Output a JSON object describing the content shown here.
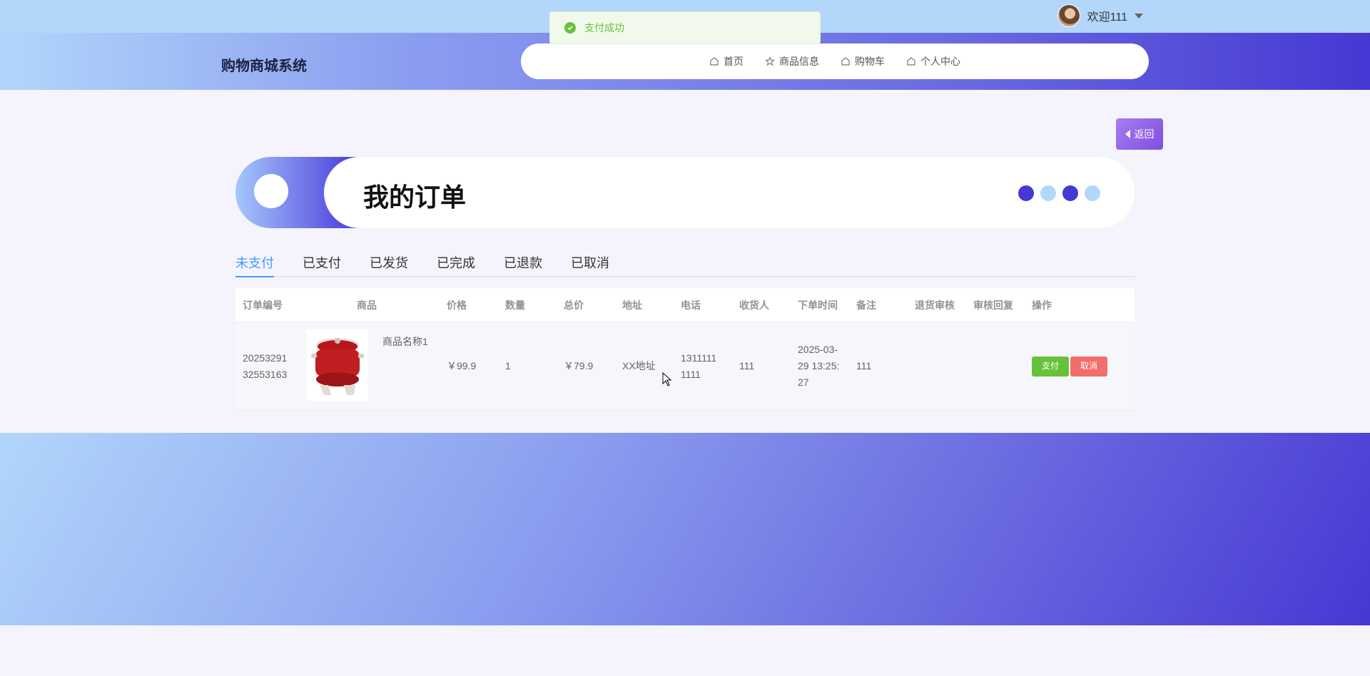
{
  "app": {
    "brand": "购物商城系统"
  },
  "user": {
    "welcome": "欢迎111"
  },
  "toast": {
    "message": "支付成功"
  },
  "nav": {
    "items": [
      {
        "label": "首页",
        "icon": "home-icon"
      },
      {
        "label": "商品信息",
        "icon": "star-icon"
      },
      {
        "label": "购物车",
        "icon": "home-icon"
      },
      {
        "label": "个人中心",
        "icon": "home-icon"
      }
    ]
  },
  "back_button": {
    "label": "返回"
  },
  "banner": {
    "title": "我的订单",
    "dot_colors": [
      "#4538d4",
      "#b2d7fb",
      "#4538d4",
      "#b2d7fb"
    ]
  },
  "tabs": [
    {
      "label": "未支付",
      "active": true
    },
    {
      "label": "已支付",
      "active": false
    },
    {
      "label": "已发货",
      "active": false
    },
    {
      "label": "已完成",
      "active": false
    },
    {
      "label": "已退款",
      "active": false
    },
    {
      "label": "已取消",
      "active": false
    }
  ],
  "table": {
    "columns": [
      "订单编号",
      "商品",
      "价格",
      "数量",
      "总价",
      "地址",
      "电话",
      "收货人",
      "下单时间",
      "备注",
      "退货审核",
      "审核回复",
      "操作"
    ],
    "rows": [
      {
        "order_id_l1": "20253291",
        "order_id_l2": "32553163",
        "goods_name": "商品名称1",
        "price": "￥99.9",
        "qty": "1",
        "total": "￥79.9",
        "address": "XX地址",
        "phone_l1": "1311111",
        "phone_l2": "1111",
        "receiver": "111",
        "time_l1": "2025-03-",
        "time_l2": "29 13:25:",
        "time_l3": "27",
        "remark": "111",
        "return_review": "",
        "review_reply": "",
        "pay_label": "支付",
        "cancel_label": "取消"
      }
    ]
  },
  "colors": {
    "accent": "#409eff",
    "success": "#67c23a",
    "danger": "#f56c6c"
  }
}
